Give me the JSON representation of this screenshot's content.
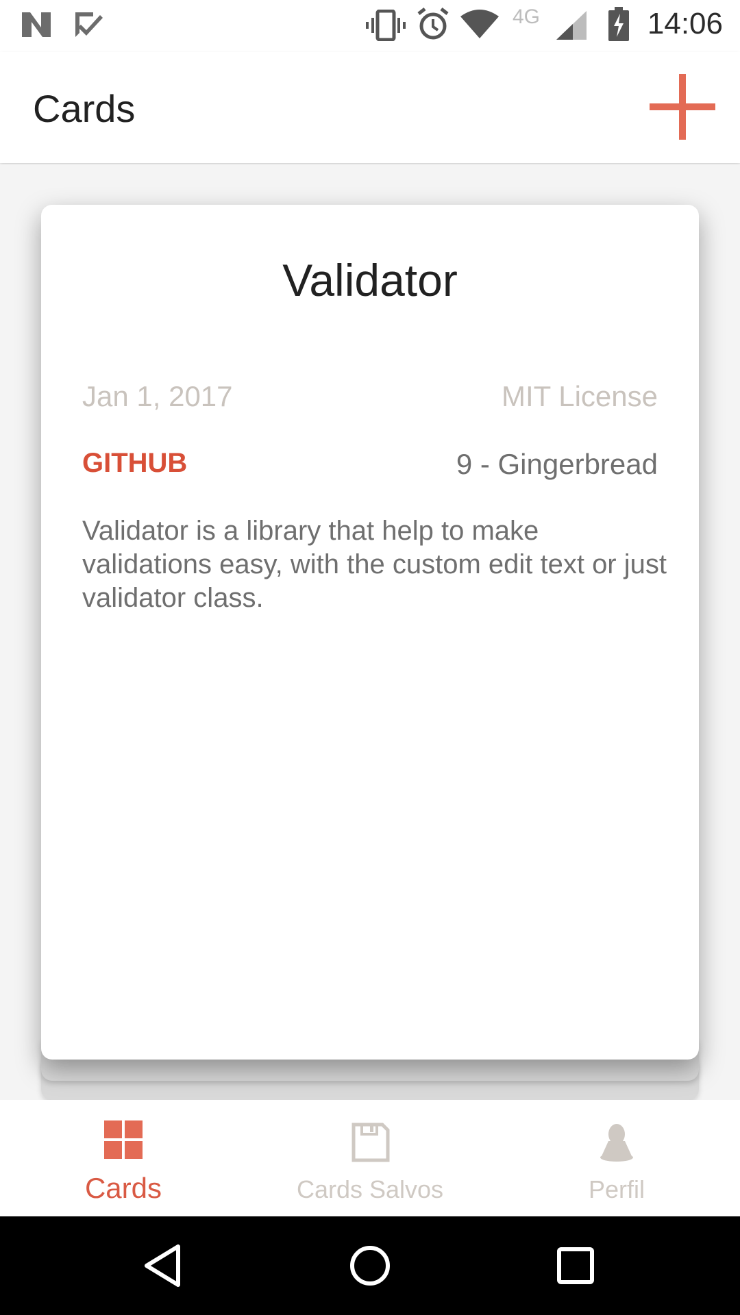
{
  "status_bar": {
    "time": "14:06",
    "network_label": "4G",
    "icons": [
      "n-logo-icon",
      "check-badge-icon",
      "vibrate-icon",
      "alarm-icon",
      "wifi-icon",
      "signal-icon",
      "battery-charging-icon"
    ]
  },
  "app_bar": {
    "title": "Cards",
    "add_icon": "plus-icon"
  },
  "card": {
    "title": "Validator",
    "date": "Jan 1, 2017",
    "license": "MIT License",
    "source": "GITHUB",
    "min_api": "9 - Gingerbread",
    "description": "Validator is a library that help to make validations easy, with the custom edit text or just validator class."
  },
  "bottom_nav": {
    "items": [
      {
        "label": "Cards",
        "icon": "grid-icon",
        "active": true
      },
      {
        "label": "Cards Salvos",
        "icon": "save-icon",
        "active": false
      },
      {
        "label": "Perfil",
        "icon": "person-icon",
        "active": false
      }
    ]
  },
  "system_nav": {
    "buttons": [
      "back-icon",
      "home-icon",
      "recents-icon"
    ]
  },
  "colors": {
    "accent": "#d95a44",
    "source_red": "#d84f37",
    "inactive": "#cfc9c3",
    "muted_text": "#c9c3bd"
  }
}
